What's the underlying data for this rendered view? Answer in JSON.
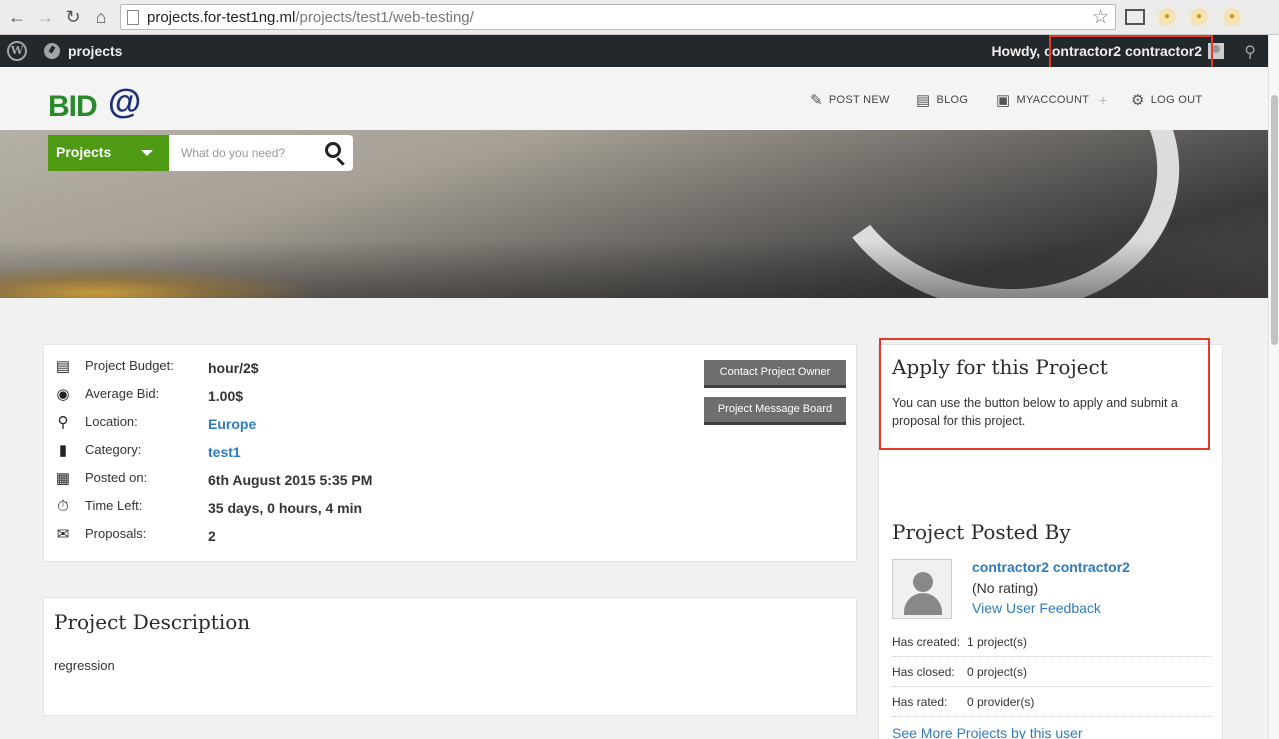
{
  "browser": {
    "url_host": "projects.for-test1ng.ml",
    "url_path": "/projects/test1/web-testing/"
  },
  "admin_bar": {
    "site_name": "projects",
    "greeting": "Howdy, contractor2 contractor2"
  },
  "header": {
    "logo_text": "BID",
    "logo_symbol": "@",
    "nav": {
      "post_new": "POST NEW",
      "blog": "BLOG",
      "myaccount": "MYACCOUNT",
      "logout": "LOG OUT"
    }
  },
  "search": {
    "category": "Projects",
    "placeholder": "What do you need?"
  },
  "project_info": {
    "rows": [
      {
        "label": "Project Budget:",
        "value": "hour/2$",
        "icon": "wallet-icon"
      },
      {
        "label": "Average Bid:",
        "value": "1.00$",
        "icon": "coins-icon"
      },
      {
        "label": "Location:",
        "value": "Europe",
        "icon": "map-pin-icon"
      },
      {
        "label": "Category:",
        "value": "test1",
        "icon": "folder-icon"
      },
      {
        "label": "Posted on:",
        "value": "6th August 2015 5:35 PM",
        "icon": "calendar-icon"
      },
      {
        "label": "Time Left:",
        "value": "35 days, 0 hours, 4 min",
        "icon": "stopwatch-icon"
      },
      {
        "label": "Proposals:",
        "value": "2",
        "icon": "proposals-icon"
      }
    ],
    "contact_button": "Contact Project Owner",
    "message_board_button": "Project Message Board"
  },
  "description": {
    "title": "Project Description",
    "text": "regression"
  },
  "apply": {
    "title": "Apply for this Project",
    "text": "You can use the button below to apply and submit a proposal for this project."
  },
  "posted_by": {
    "title": "Project Posted By",
    "name": "contractor2 contractor2",
    "rating": "(No rating)",
    "feedback_link": "View User Feedback",
    "stats": [
      {
        "label": "Has created:",
        "value": "1 project(s)"
      },
      {
        "label": "Has closed:",
        "value": "0 project(s)"
      },
      {
        "label": "Has rated:",
        "value": "0 provider(s)"
      }
    ],
    "more_link": "See More Projects by this user"
  },
  "colors": {
    "accent_green": "#4e9a12",
    "link_blue": "#2d7bbf",
    "highlight_red": "#e53a2a",
    "admin_bar": "#23282d"
  }
}
